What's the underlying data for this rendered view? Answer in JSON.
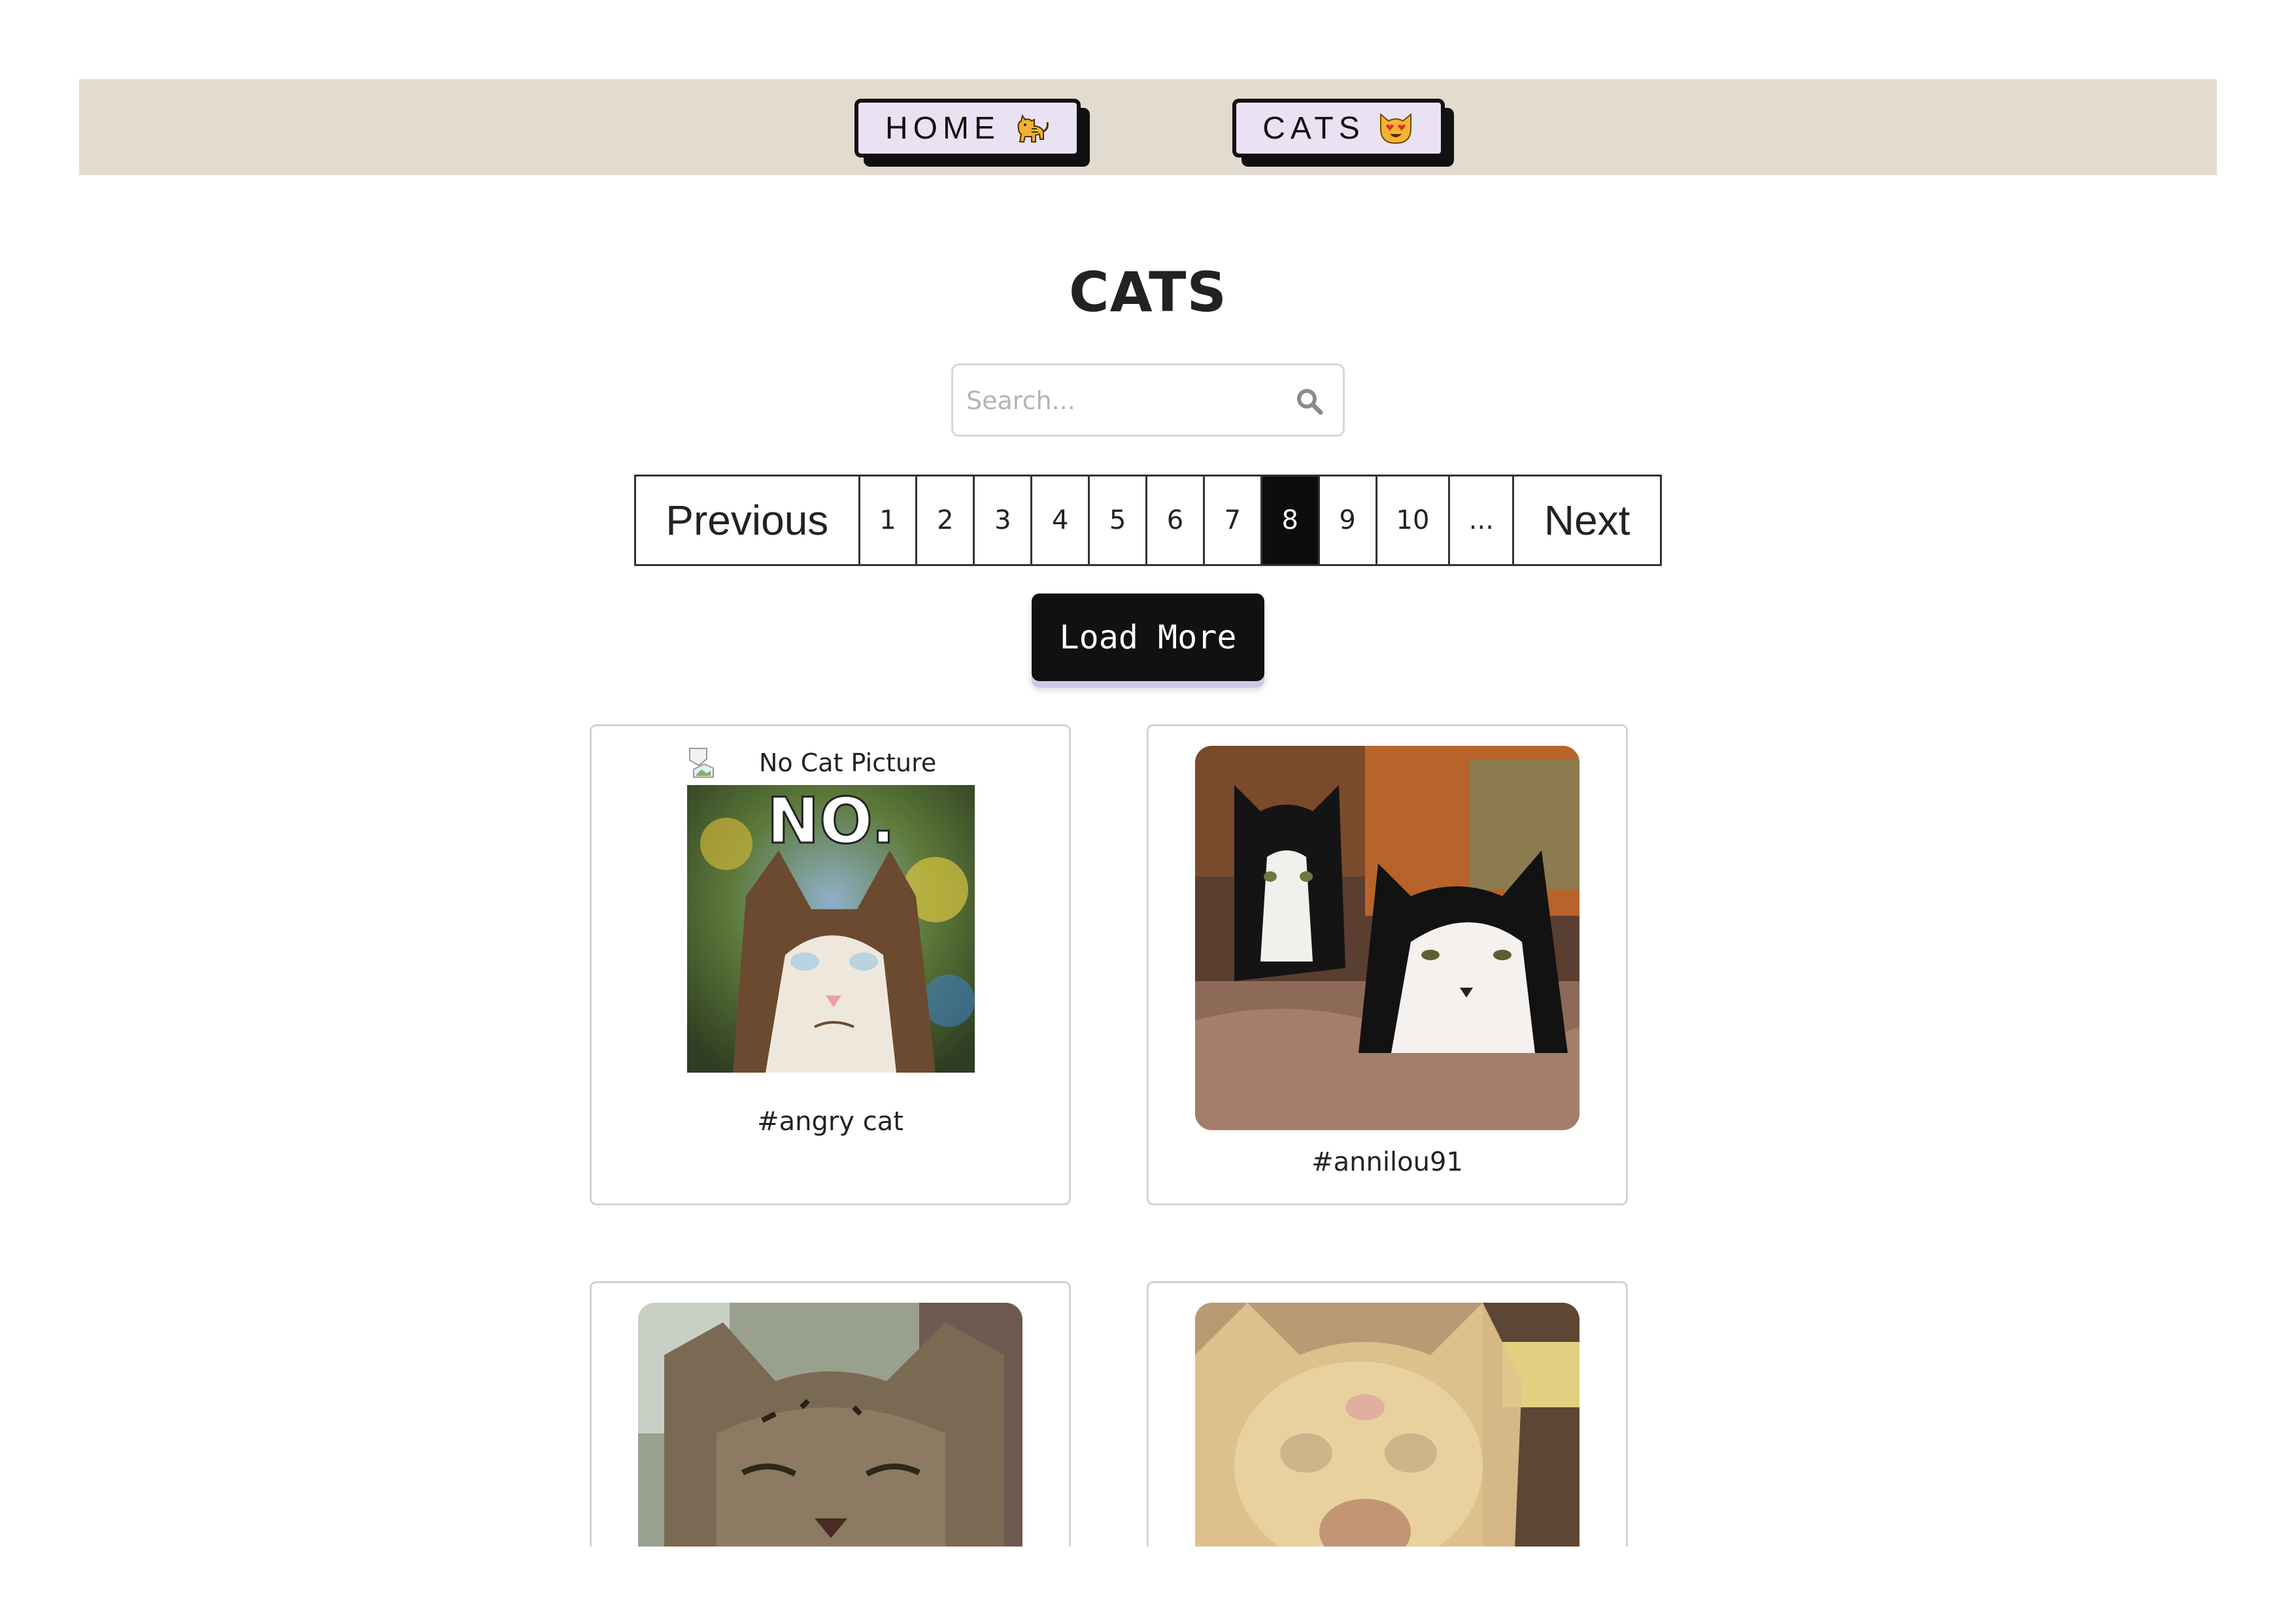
{
  "nav": {
    "home_label": "HOME",
    "home_icon": "cat-walking-icon",
    "cats_label": "CATS",
    "cats_icon": "heart-eyes-cat-icon"
  },
  "page_title": "CATS",
  "search": {
    "placeholder": "Search...",
    "value": ""
  },
  "pagination": {
    "previous_label": "Previous",
    "next_label": "Next",
    "pages": [
      "1",
      "2",
      "3",
      "4",
      "5",
      "6",
      "7",
      "8",
      "9",
      "10"
    ],
    "active_page": "8",
    "ellipsis": "..."
  },
  "load_more_label": "Load More",
  "cards": [
    {
      "alt_text": "No Cat Picture",
      "image_text": "NO.",
      "caption": "#angry cat"
    },
    {
      "caption": "#annilou91"
    },
    {
      "caption": ""
    },
    {
      "caption": ""
    }
  ],
  "colors": {
    "nav_background": "#e2dbcf",
    "nav_button_background": "#e9e2f2",
    "active_page_background": "#0d0d0d",
    "load_more_background": "#111111"
  }
}
